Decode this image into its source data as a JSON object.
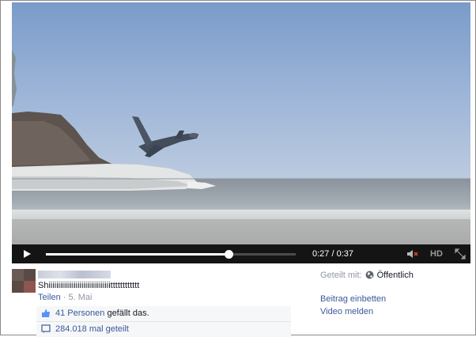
{
  "video": {
    "time_display": "0:27 / 0:37",
    "progress_fraction": 0.73,
    "hd_label": "HD"
  },
  "post": {
    "text": "Shiiiiiiiiiiiiiiiiiiiiiiiiiiiiiiiitttttttttttt",
    "share_link": "Teilen",
    "separator": " · ",
    "date": "5. Mai"
  },
  "ufi": {
    "likes_count": "41 Personen",
    "likes_suffix": " gefällt das.",
    "shares": "284.018 mal geteilt"
  },
  "sidebar": {
    "shared_with_label": "Geteilt mit:",
    "shared_with_value": "Öffentlich",
    "embed_link": "Beitrag einbetten",
    "report_link": "Video melden"
  },
  "colors": {
    "link": "#3b5998",
    "meta": "#9197a3",
    "controls_bg": "#141414"
  }
}
